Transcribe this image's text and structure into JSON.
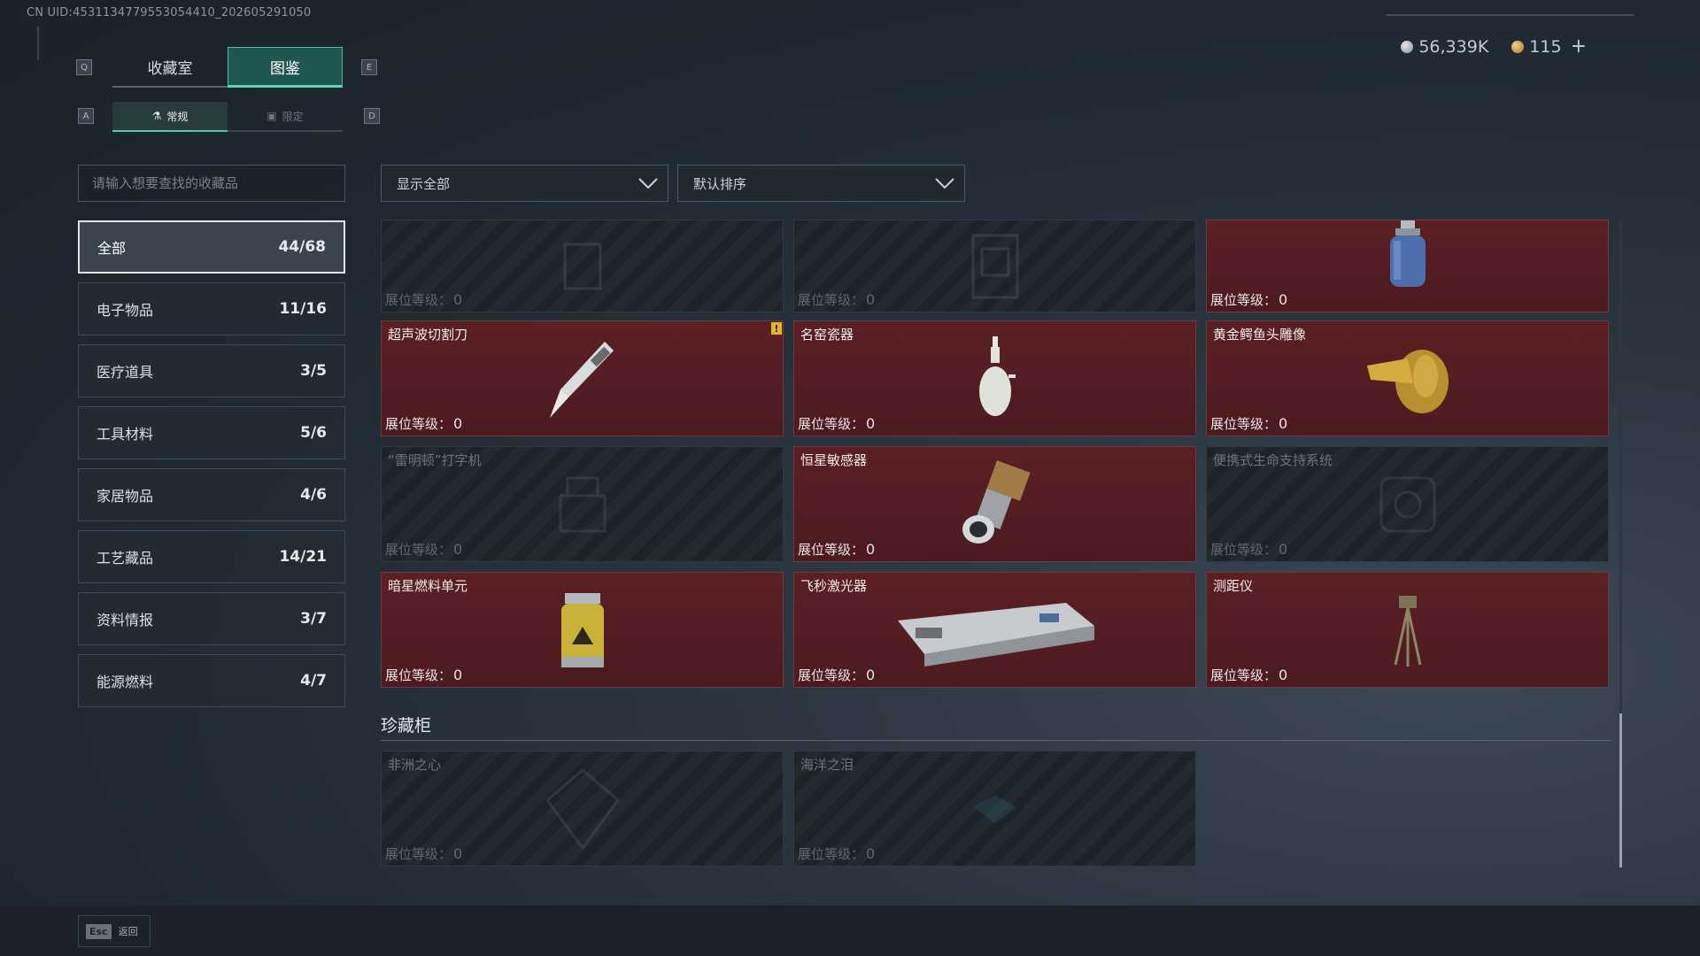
{
  "uid": "CN UID:4531134779553054410_202605291050",
  "currency": [
    {
      "icon": "silver-coin-icon",
      "value": "56,339K"
    },
    {
      "icon": "gold-coin-icon",
      "value": "115"
    }
  ],
  "currency_plus": "+",
  "keys": {
    "tab_left": "Q",
    "tab_right": "E",
    "sub_left": "A",
    "sub_right": "D"
  },
  "main_tabs": [
    {
      "label": "收藏室",
      "active": false
    },
    {
      "label": "图鉴",
      "active": true
    }
  ],
  "sub_tabs": [
    {
      "label": "常规",
      "icon": "flask-icon",
      "active": true
    },
    {
      "label": "限定",
      "icon": "image-icon",
      "active": false
    }
  ],
  "search": {
    "placeholder": "请输入想要查找的收藏品"
  },
  "categories": [
    {
      "label": "全部",
      "count": "44/68",
      "active": true
    },
    {
      "label": "电子物品",
      "count": "11/16"
    },
    {
      "label": "医疗道具",
      "count": "3/5"
    },
    {
      "label": "工具材料",
      "count": "5/6"
    },
    {
      "label": "家居物品",
      "count": "4/6"
    },
    {
      "label": "工艺藏品",
      "count": "14/21"
    },
    {
      "label": "资料情报",
      "count": "3/7"
    },
    {
      "label": "能源燃料",
      "count": "4/7"
    }
  ],
  "filters": {
    "show": "显示全部",
    "sort": "默认排序"
  },
  "level_label": "展位等级：",
  "items": [
    {
      "name": "",
      "level": "0",
      "owned": false,
      "icon": "faded-item-icon"
    },
    {
      "name": "",
      "level": "0",
      "owned": false,
      "icon": "faded-item-icon"
    },
    {
      "name": "",
      "level": "0",
      "owned": true,
      "icon": "gas-canister-icon"
    },
    {
      "name": "超声波切割刀",
      "level": "0",
      "owned": true,
      "icon": "cutting-knife-icon",
      "alert": "!"
    },
    {
      "name": "名窑瓷器",
      "level": "0",
      "owned": true,
      "icon": "porcelain-vase-icon"
    },
    {
      "name": "黄金鳄鱼头雕像",
      "level": "0",
      "owned": true,
      "icon": "gold-crocodile-icon"
    },
    {
      "name": "“雷明顿”打字机",
      "level": "0",
      "owned": false,
      "icon": "typewriter-icon"
    },
    {
      "name": "恒星敏感器",
      "level": "0",
      "owned": true,
      "icon": "star-sensor-icon"
    },
    {
      "name": "便携式生命支持系统",
      "level": "0",
      "owned": false,
      "icon": "life-support-icon"
    },
    {
      "name": "暗星燃料单元",
      "level": "0",
      "owned": true,
      "icon": "fuel-cell-icon"
    },
    {
      "name": "飞秒激光器",
      "level": "0",
      "owned": true,
      "icon": "laser-device-icon"
    },
    {
      "name": "测距仪",
      "level": "0",
      "owned": true,
      "icon": "rangefinder-icon"
    }
  ],
  "section": {
    "title": "珍藏柜"
  },
  "treasures": [
    {
      "name": "非洲之心",
      "level": "0",
      "owned": false,
      "icon": "gem-icon"
    },
    {
      "name": "海洋之泪",
      "level": "0",
      "owned": false,
      "icon": "gem-icon"
    }
  ],
  "footer": {
    "esc": "Esc",
    "back": "返回"
  }
}
